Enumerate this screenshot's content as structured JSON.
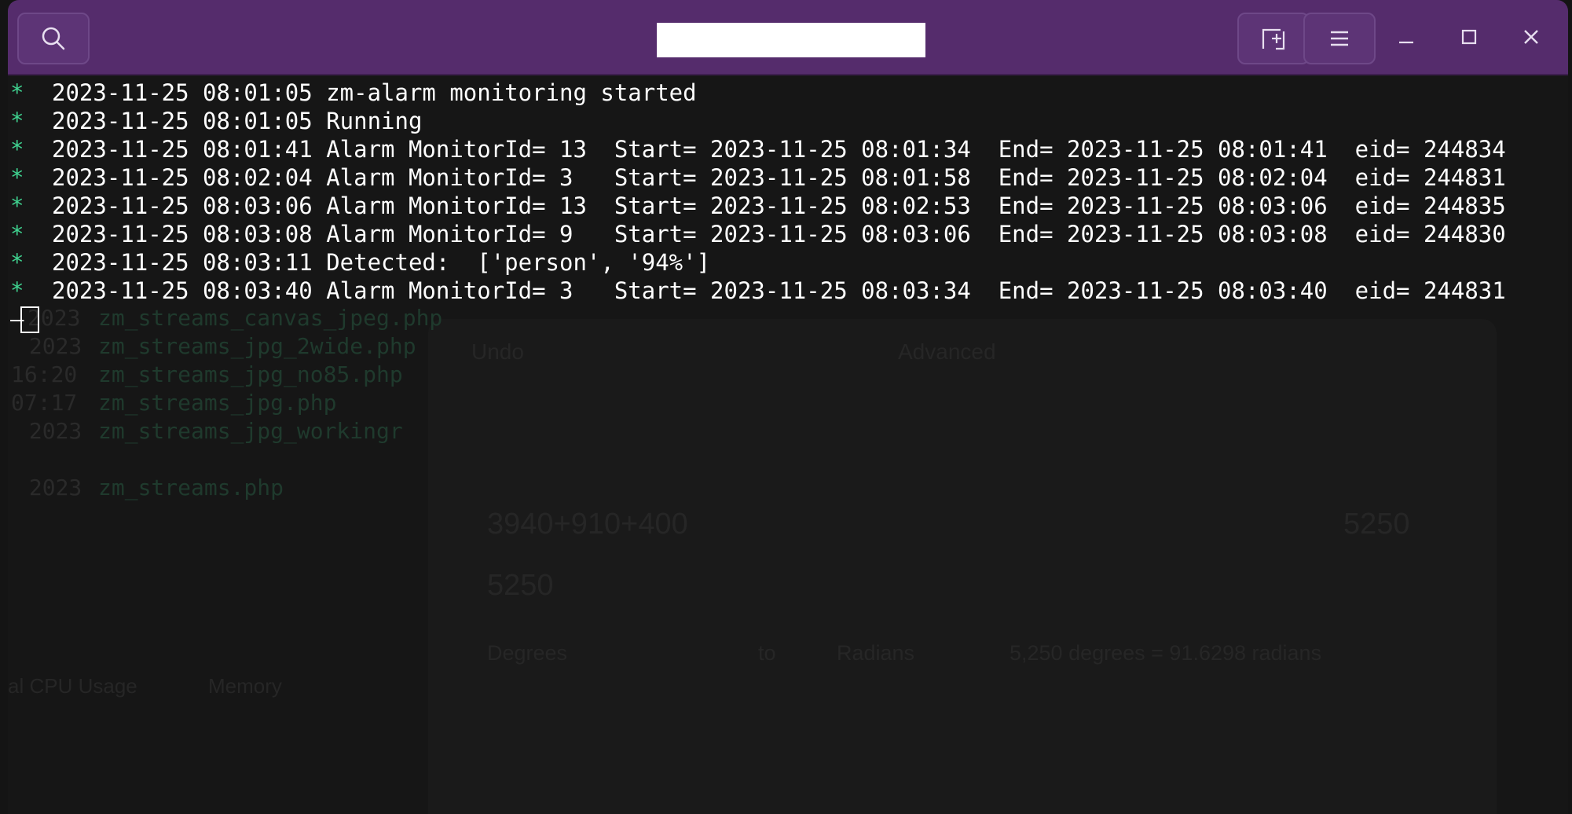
{
  "window": {
    "title": "",
    "accent": "#552c6c"
  },
  "header": {
    "search_icon": "search-icon",
    "new_tab_icon": "new-tab-icon",
    "menu_icon": "hamburger-menu-icon",
    "minimize_icon": "minimize-icon",
    "maximize_icon": "maximize-icon",
    "close_icon": "close-icon"
  },
  "terminal": {
    "bullet": "*",
    "lines": [
      "2023-11-25 08:01:05 zm-alarm monitoring started",
      "2023-11-25 08:01:05 Running",
      "2023-11-25 08:01:41 Alarm MonitorId= 13  Start= 2023-11-25 08:01:34  End= 2023-11-25 08:01:41  eid= 244834",
      "2023-11-25 08:02:04 Alarm MonitorId= 3   Start= 2023-11-25 08:01:58  End= 2023-11-25 08:02:04  eid= 244831",
      "2023-11-25 08:03:06 Alarm MonitorId= 13  Start= 2023-11-25 08:02:53  End= 2023-11-25 08:03:06  eid= 244835",
      "2023-11-25 08:03:08 Alarm MonitorId= 9   Start= 2023-11-25 08:03:06  End= 2023-11-25 08:03:08  eid= 244830",
      "2023-11-25 08:03:11 Detected:  ['person', '94%']",
      "2023-11-25 08:03:40 Alarm MonitorId= 3   Start= 2023-11-25 08:03:34  End= 2023-11-25 08:03:40  eid= 244831"
    ],
    "prompt_char": "–"
  },
  "background_ghost": {
    "files": [
      {
        "date": "2023",
        "name": "zm_streams_canvas_jpeg.php"
      },
      {
        "date": " 2023",
        "name": "zm_streams_jpg_2wide.php"
      },
      {
        "date": "16:20",
        "name": "zm_streams_jpg_no85.php"
      },
      {
        "date": "07:17",
        "name": "zm_streams_jpg.php"
      },
      {
        "date": " 2023",
        "name": "zm_streams_jpg_workingr"
      },
      {
        "date": " 2023",
        "name": "zm_streams.php"
      }
    ],
    "calc": {
      "undo": "Undo",
      "mode": "Advanced",
      "expression": "3940+910+400",
      "result_right": "5250",
      "result": "5250",
      "from_unit": "Degrees",
      "to_label": "to",
      "to_unit": "Radians",
      "conversion": "5,250 degrees = 91.6298 radians"
    },
    "monitor": {
      "cpu_label": "al CPU Usage",
      "memory_label": "Memory"
    }
  }
}
